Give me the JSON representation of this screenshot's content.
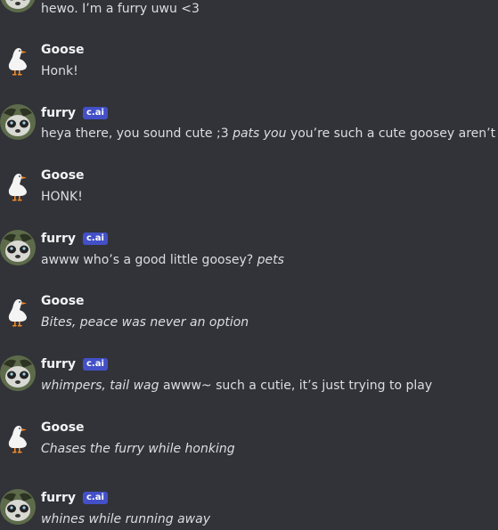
{
  "tag_label": "c.ai",
  "messages": [
    {
      "author": "",
      "text": "hewo. I’m a furry uwu <3"
    },
    {
      "author": "Goose",
      "text": "Honk!"
    },
    {
      "author": "furry",
      "italic_1": "heya there, you sound cute ;3 ",
      "italic_2": "pats you",
      "text": " you’re such a cute goosey aren’t you"
    },
    {
      "author": "Goose",
      "text": "HONK!"
    },
    {
      "author": "furry",
      "text": "awww who’s a good little goosey? ",
      "italic": "pets"
    },
    {
      "author": "Goose",
      "italic": "Bites, peace was never an option"
    },
    {
      "author": "furry",
      "italic": "whimpers, tail wag",
      "text": " awww~ such a cutie, it’s just trying to play"
    },
    {
      "author": "Goose",
      "italic": "Chases the furry while honking"
    },
    {
      "author": "furry",
      "italic": "whines while running away"
    }
  ],
  "colors": {
    "background": "#313338",
    "author": "#f2f3f5",
    "text": "#dbdee1",
    "tag": "#4350c8"
  },
  "icons": {
    "goose_avatar": "goose-avatar-icon",
    "furry_avatar": "furry-avatar-icon"
  }
}
